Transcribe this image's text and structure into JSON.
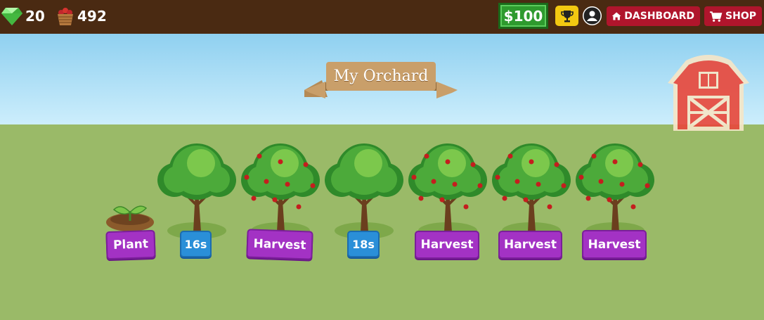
{
  "topbar": {
    "gems": "20",
    "apples": "492",
    "money": "$100",
    "dashboard_label": "DASHBOARD",
    "shop_label": "SHOP"
  },
  "scene": {
    "title": "My Orchard"
  },
  "plots": [
    {
      "label": "Plant",
      "state": "seedling",
      "action": "plant"
    },
    {
      "label": "16s",
      "state": "growing",
      "action": "timer"
    },
    {
      "label": "Harvest",
      "state": "fruiting",
      "action": "harvest"
    },
    {
      "label": "18s",
      "state": "growing",
      "action": "timer"
    },
    {
      "label": "Harvest",
      "state": "fruiting",
      "action": "harvest"
    },
    {
      "label": "Harvest",
      "state": "fruiting",
      "action": "harvest"
    },
    {
      "label": "Harvest",
      "state": "fruiting",
      "action": "harvest"
    }
  ],
  "colors": {
    "topbar": "#4a2a12",
    "action_purple": "#a332c4",
    "timer_blue": "#2a8fd8",
    "money_green": "#2e9a2e",
    "nav_red": "#b0152c",
    "grass": "#9aba68"
  },
  "icons": [
    "gem-icon",
    "apple-basket-icon",
    "trophy-icon",
    "account-icon",
    "home-icon",
    "cart-icon",
    "barn-icon"
  ]
}
